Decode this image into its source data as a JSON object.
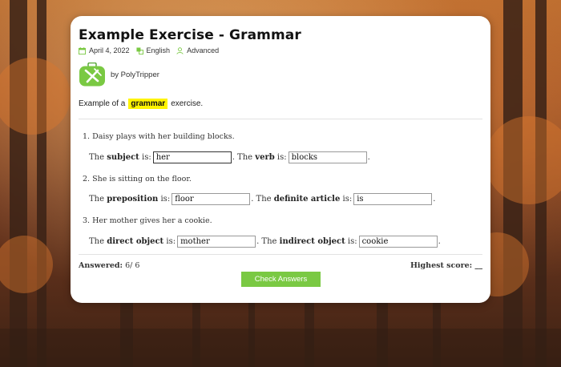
{
  "exercise": {
    "title": "Example Exercise - Grammar",
    "meta": {
      "date": "April 4, 2022",
      "language": "English",
      "level": "Advanced"
    },
    "author": "by PolyTripper",
    "intro": {
      "before": "Example of a",
      "highlight": "grammar",
      "after": "exercise."
    },
    "questions": [
      {
        "number": "1.",
        "text": "Daisy plays with her building blocks.",
        "parts": [
          {
            "prefix": "The",
            "term": "subject",
            "suffix": "is:",
            "value": "her"
          },
          {
            "prefix": ". The",
            "term": "verb",
            "suffix": "is:",
            "value": "blocks"
          }
        ]
      },
      {
        "number": "2.",
        "text": "She is sitting on the floor.",
        "parts": [
          {
            "prefix": "The",
            "term": "preposition",
            "suffix": "is:",
            "value": "floor"
          },
          {
            "prefix": ". The",
            "term": "definite article",
            "suffix": "is:",
            "value": "is"
          }
        ]
      },
      {
        "number": "3.",
        "text": "Her mother gives her a cookie.",
        "parts": [
          {
            "prefix": "The",
            "term": "direct object",
            "suffix": "is:",
            "value": "mother"
          },
          {
            "prefix": ". The",
            "term": "indirect object",
            "suffix": "is:",
            "value": "cookie"
          }
        ]
      }
    ],
    "row_end": ".",
    "footer": {
      "answered_label": "Answered:",
      "answered_value": "6/ 6",
      "highest_score": "Highest score: __"
    },
    "check_button": "Check Answers"
  },
  "colors": {
    "accent": "#7ac943",
    "highlight": "#fff400",
    "meta_icon": "#7ac943"
  },
  "icons": {
    "date": "calendar-icon",
    "language": "language-icon",
    "level": "user-icon",
    "logo": "polytripper-logo-icon"
  }
}
